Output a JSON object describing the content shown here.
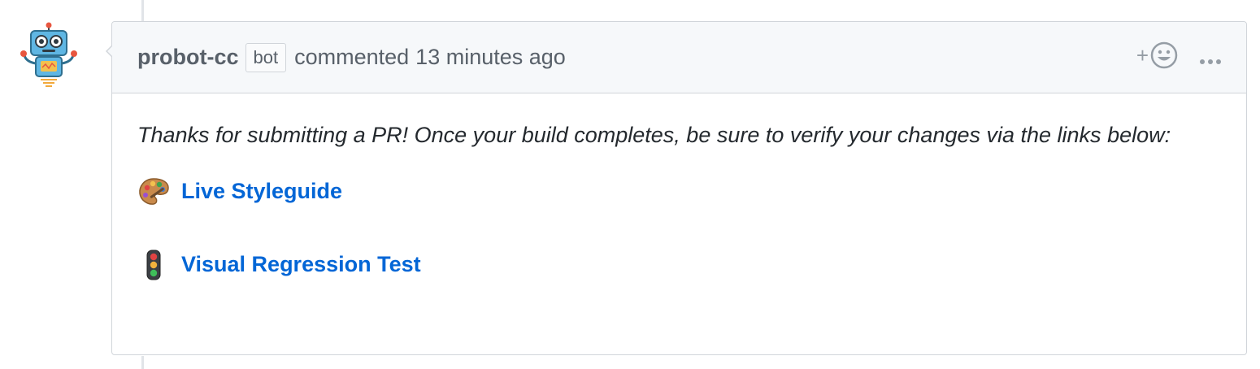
{
  "comment": {
    "author": "probot-cc",
    "author_badge": "bot",
    "action": "commented",
    "timestamp": "13 minutes ago",
    "reaction_plus": "+",
    "body": {
      "intro": "Thanks for submitting a PR! Once your build completes, be sure to verify your changes via the links below:",
      "links": [
        {
          "emoji": "palette-emoji",
          "label": "Live Styleguide"
        },
        {
          "emoji": "traffic-light-emoji",
          "label": "Visual Regression Test"
        }
      ]
    }
  },
  "colors": {
    "link": "#0366d6",
    "header_bg": "#f6f8fa",
    "border": "#d1d5da",
    "muted_text": "#586069"
  }
}
